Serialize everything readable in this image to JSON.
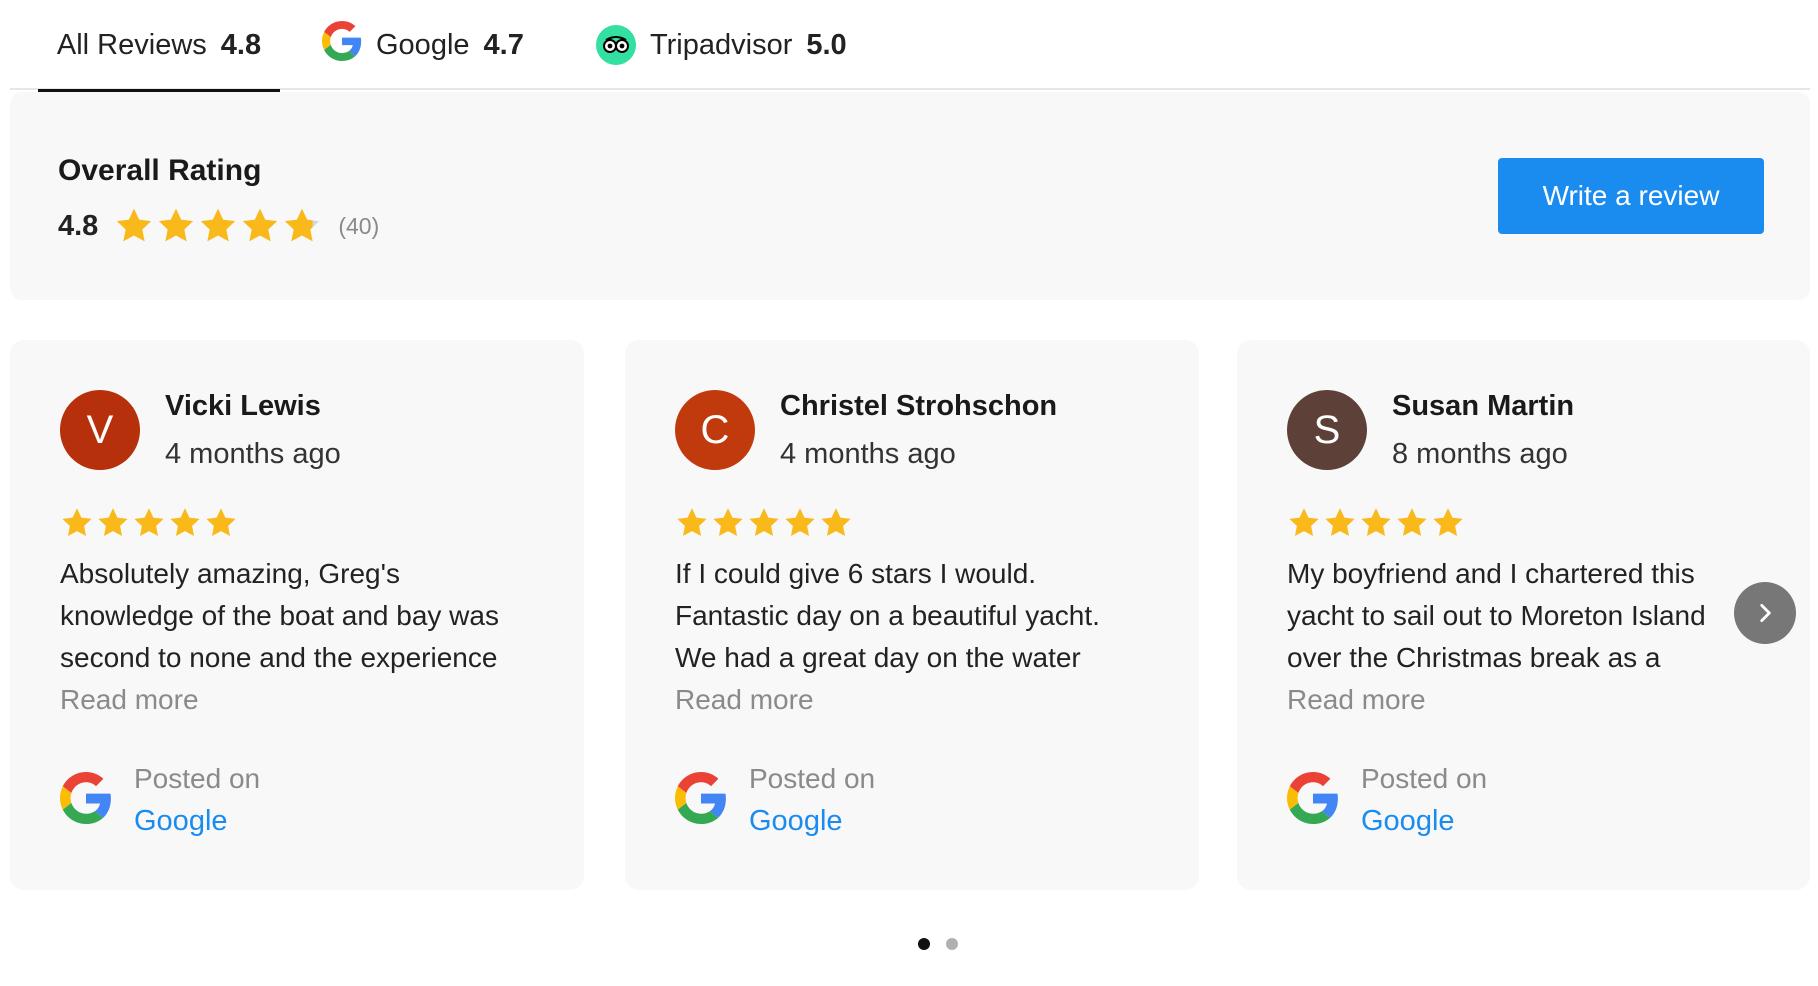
{
  "tabs": [
    {
      "label": "All Reviews",
      "score": "4.8"
    },
    {
      "label": "Google",
      "score": "4.7",
      "icon": "google-icon"
    },
    {
      "label": "Tripadvisor",
      "score": "5.0",
      "icon": "tripadvisor-icon"
    }
  ],
  "overall": {
    "title": "Overall Rating",
    "score": "4.8",
    "rating": 4.8,
    "count": "(40)",
    "write_label": "Write a review"
  },
  "reviews": [
    {
      "initial": "V",
      "name": "Vicki Lewis",
      "date": "4 months ago",
      "rating": 5,
      "text_lines": [
        "Absolutely amazing, Greg's",
        "knowledge of the boat and bay was",
        "second to none and the experience"
      ],
      "read_more": "Read more",
      "posted_label": "Posted on",
      "source": "Google",
      "avatar_color": "#b5300b"
    },
    {
      "initial": "C",
      "name": "Christel Strohschon",
      "date": "4 months ago",
      "rating": 5,
      "text_lines": [
        "If I could give 6 stars I would.",
        "Fantastic day on a beautiful yacht.",
        "We had a great day on the water"
      ],
      "read_more": "Read more",
      "posted_label": "Posted on",
      "source": "Google",
      "avatar_color": "#c13a0d"
    },
    {
      "initial": "S",
      "name": "Susan Martin",
      "date": "8 months ago",
      "rating": 5,
      "text_lines": [
        "My boyfriend and I chartered this",
        "yacht to sail out to Moreton Island",
        "over the Christmas break as a"
      ],
      "read_more": "Read more",
      "posted_label": "Posted on",
      "source": "Google",
      "avatar_color": "#5d4037"
    }
  ],
  "carousel": {
    "pages": 2,
    "current": 1
  },
  "colors": {
    "accent": "#1a8cf0",
    "star": "#f9b91a",
    "tripadvisor": "#34e0a1"
  }
}
